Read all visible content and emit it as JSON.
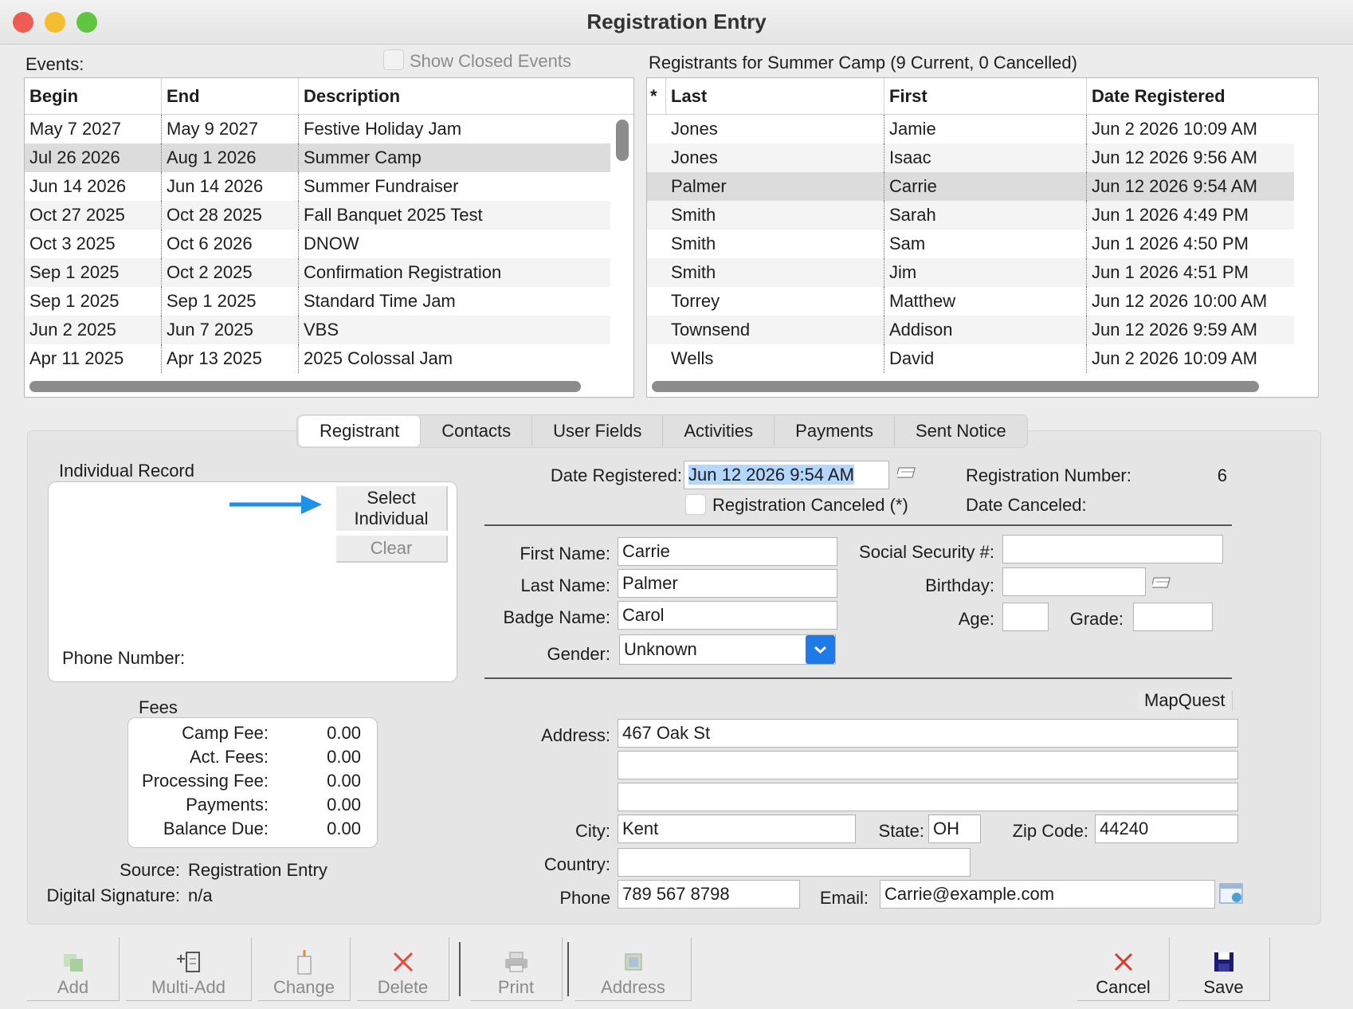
{
  "window": {
    "title": "Registration Entry"
  },
  "events": {
    "label": "Events:",
    "show_closed_label": "Show Closed Events",
    "columns": [
      "Begin",
      "End",
      "Description"
    ],
    "rows": [
      [
        "May 7 2027",
        "May 9 2027",
        "Festive Holiday Jam"
      ],
      [
        "Jul 26 2026",
        "Aug 1 2026",
        "Summer Camp"
      ],
      [
        "Jun 14 2026",
        "Jun 14 2026",
        "Summer Fundraiser"
      ],
      [
        "Oct 27 2025",
        "Oct 28 2025",
        "Fall Banquet 2025 Test"
      ],
      [
        "Oct 3 2025",
        "Oct 6 2026",
        "DNOW"
      ],
      [
        "Sep 1 2025",
        "Oct 2 2025",
        "Confirmation Registration"
      ],
      [
        "Sep 1 2025",
        "Sep 1 2025",
        "Standard Time Jam"
      ],
      [
        "Jun 2 2025",
        "Jun 7 2025",
        "VBS"
      ],
      [
        "Apr 11 2025",
        "Apr 13 2025",
        "2025 Colossal Jam"
      ]
    ]
  },
  "registrants": {
    "label": "Registrants for Summer Camp (9 Current, 0 Cancelled)",
    "columns": [
      "*",
      "Last",
      "First",
      "Date Registered"
    ],
    "rows": [
      [
        "",
        "Jones",
        "Jamie",
        "Jun 2 2026 10:09 AM"
      ],
      [
        "",
        "Jones",
        "Isaac",
        "Jun 12 2026 9:56 AM"
      ],
      [
        "",
        "Palmer",
        "Carrie",
        "Jun 12 2026 9:54 AM"
      ],
      [
        "",
        "Smith",
        "Sarah",
        "Jun 1 2026 4:49 PM"
      ],
      [
        "",
        "Smith",
        "Sam",
        "Jun 1 2026 4:50 PM"
      ],
      [
        "",
        "Smith",
        "Jim",
        "Jun 1 2026 4:51 PM"
      ],
      [
        "",
        "Torrey",
        "Matthew",
        "Jun 12 2026 10:00 AM"
      ],
      [
        "",
        "Townsend",
        "Addison",
        "Jun 12 2026 9:59 AM"
      ],
      [
        "",
        "Wells",
        "David",
        "Jun 2 2026 10:09 AM"
      ]
    ]
  },
  "tabs": [
    "Registrant",
    "Contacts",
    "User Fields",
    "Activities",
    "Payments",
    "Sent Notice"
  ],
  "individual": {
    "title": "Individual Record",
    "select_label": "Select Individual",
    "select_line1": "Select",
    "select_line2": "Individual",
    "clear_label": "Clear",
    "phone_label": "Phone Number:"
  },
  "fees": {
    "title": "Fees",
    "items": [
      [
        "Camp Fee:",
        "0.00"
      ],
      [
        "Act. Fees:",
        "0.00"
      ],
      [
        "Processing Fee:",
        "0.00"
      ],
      [
        "Payments:",
        "0.00"
      ],
      [
        "Balance Due:",
        "0.00"
      ]
    ]
  },
  "source": {
    "label": "Source:",
    "value": "Registration Entry"
  },
  "signature": {
    "label": "Digital Signature:",
    "value": "n/a"
  },
  "form": {
    "date_registered_label": "Date Registered:",
    "date_registered": "Jun 12 2026 9:54 AM",
    "reg_number_label": "Registration Number:",
    "reg_number": "6",
    "canceled_label": "Registration Canceled (*)",
    "date_canceled_label": "Date Canceled:",
    "first_name_label": "First Name:",
    "first_name": "Carrie",
    "last_name_label": "Last Name:",
    "last_name": "Palmer",
    "badge_name_label": "Badge Name:",
    "badge_name": "Carol",
    "gender_label": "Gender:",
    "gender": "Unknown",
    "ssn_label": "Social Security #:",
    "ssn": "",
    "birthday_label": "Birthday:",
    "birthday": "",
    "age_label": "Age:",
    "age": "",
    "grade_label": "Grade:",
    "grade": "",
    "mapquest_label": "MapQuest",
    "address_label": "Address:",
    "address1": "467 Oak St",
    "address2": "",
    "address3": "",
    "city_label": "City:",
    "city": "Kent",
    "state_label": "State:",
    "state": "OH",
    "zip_label": "Zip Code:",
    "zip": "44240",
    "country_label": "Country:",
    "country": "",
    "phone_label": "Phone",
    "phone": "789 567 8798",
    "email_label": "Email:",
    "email": "Carrie@example.com"
  },
  "toolbar": {
    "add": "Add",
    "multi_add": "Multi-Add",
    "change": "Change",
    "delete": "Delete",
    "print": "Print",
    "address": "Address",
    "cancel": "Cancel",
    "save": "Save"
  },
  "colors": {
    "accent": "#1e90e6",
    "close": "#ee5c54",
    "minimize": "#f5bd30",
    "zoom": "#5fc641",
    "delete_x": "#e64a3c"
  }
}
